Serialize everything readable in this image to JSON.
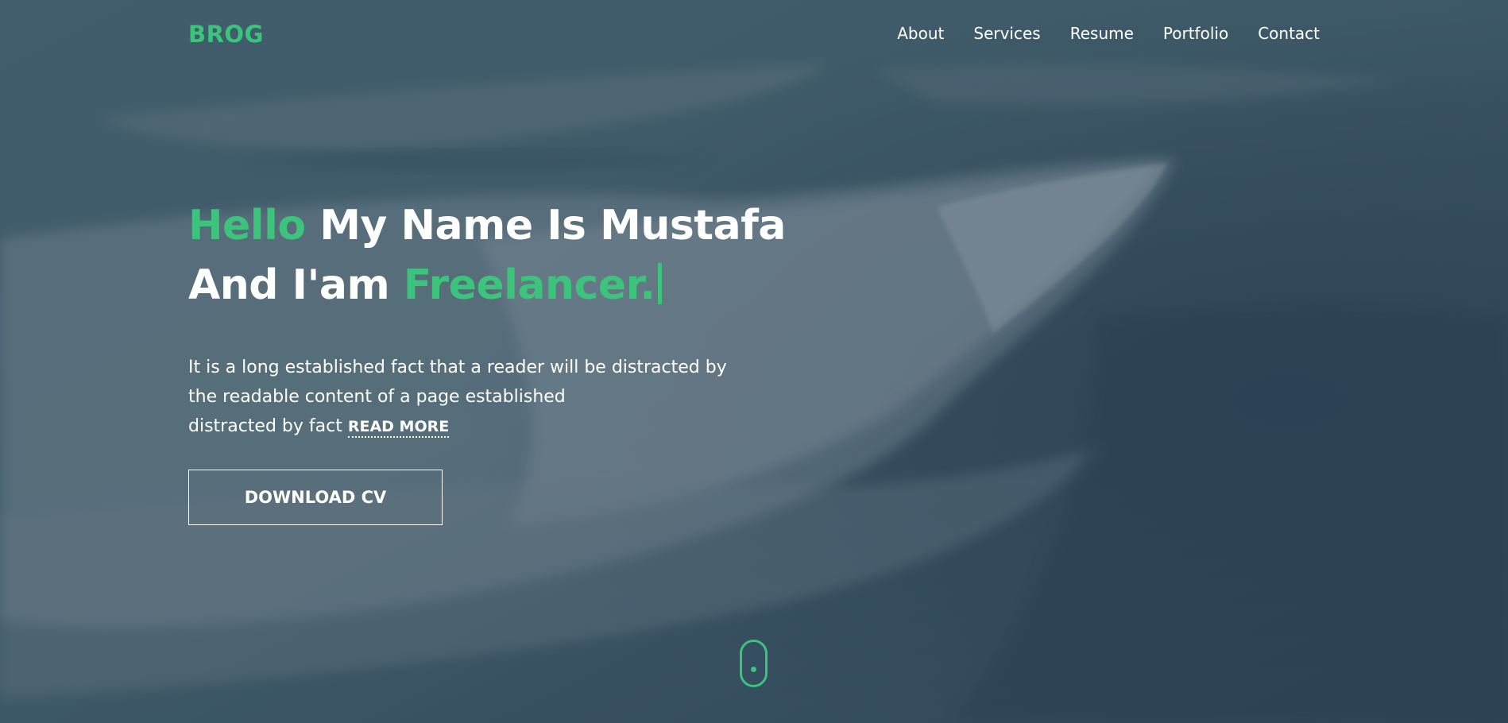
{
  "theme": {
    "accent": "#3cc47c",
    "text": "#ffffff",
    "background": "#3b5363"
  },
  "nav": {
    "logo": "BROG",
    "items": [
      {
        "label": "About"
      },
      {
        "label": "Services"
      },
      {
        "label": "Resume"
      },
      {
        "label": "Portfolio"
      },
      {
        "label": "Contact"
      }
    ]
  },
  "hero": {
    "line1_accent": "Hello",
    "line1_rest": "My Name Is Mustafa",
    "line2_rest": "And I'am",
    "line2_accent": "Freelancer.",
    "description": {
      "line1": "It is a long established fact that a reader will be distracted by",
      "line2": "the readable content of a page established",
      "line3": "distracted by fact"
    },
    "read_more": "READ MORE",
    "cta": "DOWNLOAD CV"
  },
  "scroll_indicator": {
    "icon": "scroll-mouse-icon"
  }
}
